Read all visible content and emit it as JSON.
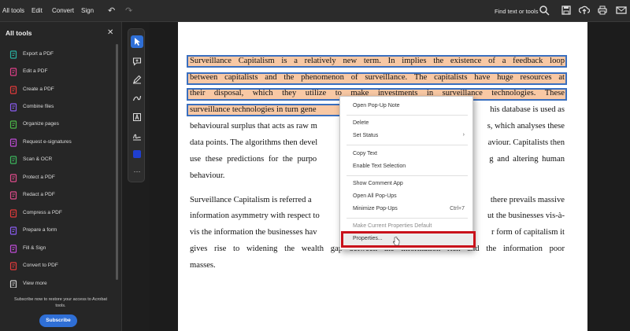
{
  "topbar": {
    "menu": [
      "All tools",
      "Edit",
      "Convert",
      "Sign"
    ],
    "find_label": "Find text or tools"
  },
  "left_panel": {
    "title": "All tools",
    "tools": [
      {
        "label": "Export a PDF",
        "icon": "export-pdf-icon",
        "color": "#29b0a0"
      },
      {
        "label": "Edit a PDF",
        "icon": "edit-pdf-icon",
        "color": "#e0408a"
      },
      {
        "label": "Create a PDF",
        "icon": "create-pdf-icon",
        "color": "#e23b3b"
      },
      {
        "label": "Combine files",
        "icon": "combine-files-icon",
        "color": "#8a5cf0"
      },
      {
        "label": "Organize pages",
        "icon": "organize-pages-icon",
        "color": "#4cb848"
      },
      {
        "label": "Request e-signatures",
        "icon": "request-esign-icon",
        "color": "#c04cd8"
      },
      {
        "label": "Scan & OCR",
        "icon": "scan-ocr-icon",
        "color": "#3cb65c"
      },
      {
        "label": "Protect a PDF",
        "icon": "protect-pdf-icon",
        "color": "#e04c8c"
      },
      {
        "label": "Redact a PDF",
        "icon": "redact-pdf-icon",
        "color": "#e04c8c"
      },
      {
        "label": "Compress a PDF",
        "icon": "compress-pdf-icon",
        "color": "#e23b3b"
      },
      {
        "label": "Prepare a form",
        "icon": "prepare-form-icon",
        "color": "#8a5cf0"
      },
      {
        "label": "Fill & Sign",
        "icon": "fill-sign-icon",
        "color": "#c04cd8"
      },
      {
        "label": "Convert to PDF",
        "icon": "convert-to-pdf-icon",
        "color": "#e23b3b"
      },
      {
        "label": "View more",
        "icon": "view-more-icon",
        "color": "#cfcfcf"
      }
    ],
    "footer_note": "Subscribe now to restore your access to Acrobat tools.",
    "subscribe_label": "Subscribe"
  },
  "document": {
    "para1": [
      "Surveillance Capitalism is a relatively new term. In implies the existence of a feedback loop",
      "between capitalists and the phenomenon of surveillance. The capitalists have huge resources at",
      "their disposal, which they utilize to make investments in surveillance technologies. These",
      "surveillance technologies in turn gene",
      "behavioural surplus that acts as raw m",
      "data points. The algorithms then devel",
      "use these predictions for the purpo",
      "behaviour."
    ],
    "para1_right": [
      "",
      "",
      "",
      "his database is used as",
      "s, which analyses these",
      "aviour. Capitalists then",
      "g and altering human",
      ""
    ],
    "para2": [
      "Surveillance Capitalism is referred a",
      "information asymmetry with respect to",
      "vis the information the businesses hav",
      "gives rise to widening the wealth gap between the information rich and the information poor",
      "masses."
    ],
    "para2_right": [
      "there prevails massive",
      "ut the businesses vis-à-",
      "r form of capitalism it",
      "",
      ""
    ]
  },
  "context_menu": {
    "items": [
      {
        "label": "Open Pop-Up Note",
        "shortcut": "",
        "disabled": false
      },
      {
        "label": "Delete",
        "shortcut": "",
        "disabled": false
      },
      {
        "label": "Set Status",
        "shortcut": "›",
        "disabled": false
      },
      {
        "label": "Copy Text",
        "shortcut": "",
        "disabled": false
      },
      {
        "label": "Enable Text Selection",
        "shortcut": "",
        "disabled": false
      },
      {
        "label": "Show Comment App",
        "shortcut": "",
        "disabled": false
      },
      {
        "label": "Open All Pop-Ups",
        "shortcut": "",
        "disabled": false
      },
      {
        "label": "Minimize Pop-Ups",
        "shortcut": "Ctrl+7",
        "disabled": false
      },
      {
        "label": "Make Current Properties Default",
        "shortcut": "",
        "disabled": true
      },
      {
        "label": "Properties...",
        "shortcut": "",
        "disabled": false
      }
    ]
  }
}
